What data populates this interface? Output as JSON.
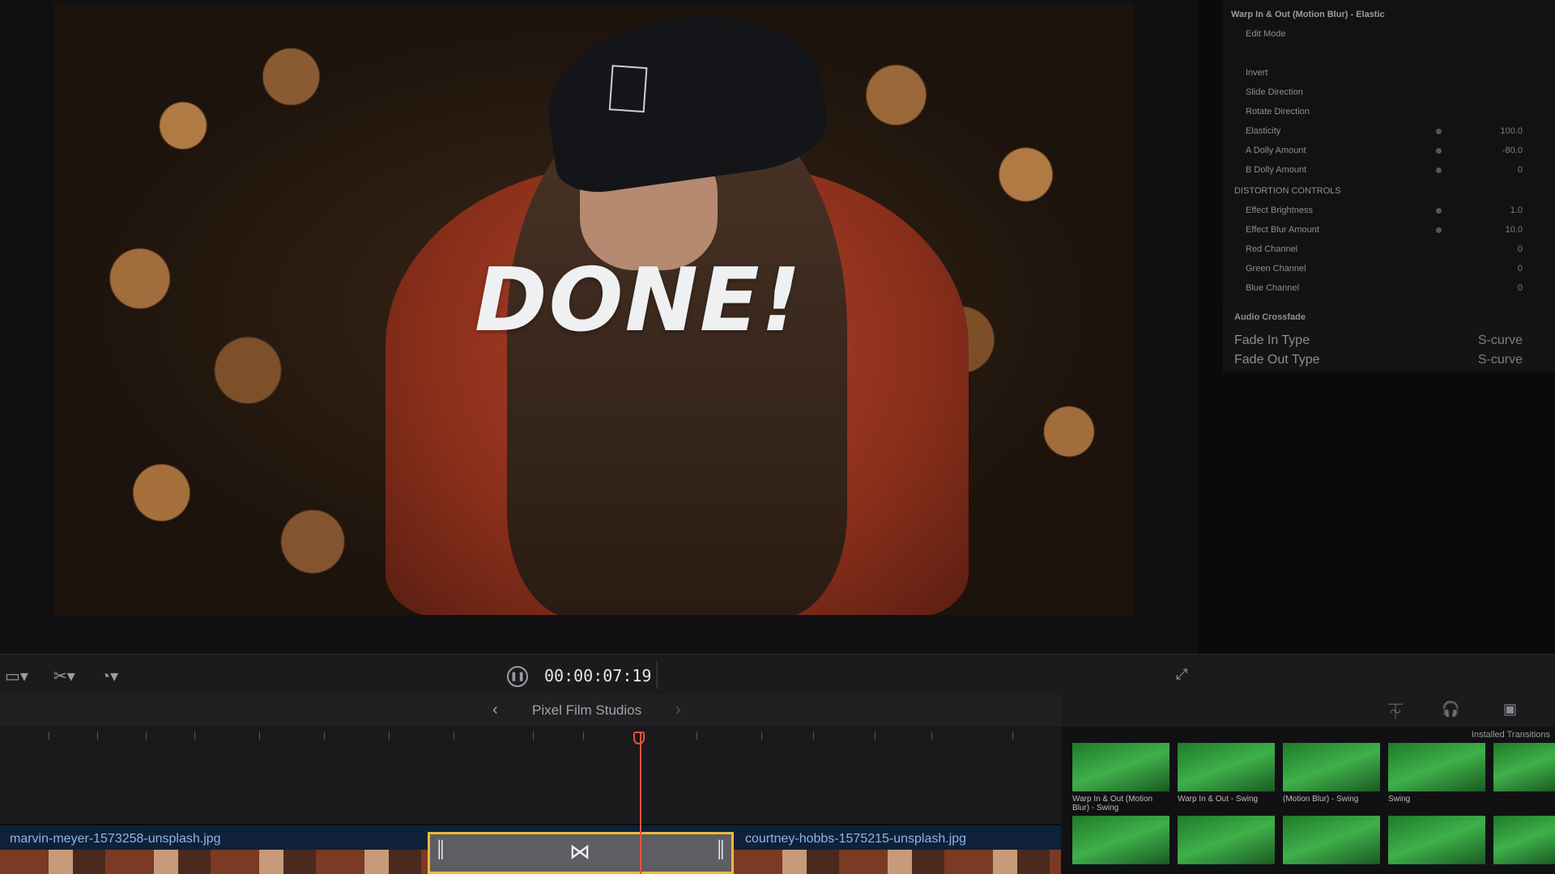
{
  "viewer": {
    "title_overlay": "DONE!"
  },
  "inspector": {
    "header": "Warp In & Out (Motion Blur) - Elastic",
    "rows": [
      {
        "label": "Edit Mode",
        "value": ""
      },
      {
        "label": "Invert",
        "value": ""
      },
      {
        "label": "Slide Direction",
        "value": ""
      },
      {
        "label": "Rotate Direction",
        "value": ""
      },
      {
        "label": "Elasticity",
        "value": "100.0"
      },
      {
        "label": "A Dolly Amount",
        "value": "-80.0"
      },
      {
        "label": "B Dolly Amount",
        "value": "0"
      }
    ],
    "distortion_section": "DISTORTION CONTROLS",
    "distortion_rows": [
      {
        "label": "Effect Brightness",
        "value": "1.0"
      },
      {
        "label": "Effect Blur Amount",
        "value": "10.0"
      },
      {
        "label": "Red Channel",
        "value": "0"
      },
      {
        "label": "Green Channel",
        "value": "0"
      },
      {
        "label": "Blue Channel",
        "value": "0"
      }
    ],
    "audio_section": "Audio Crossfade",
    "audio_rows": [
      {
        "label": "Fade In Type",
        "value": "S-curve"
      },
      {
        "label": "Fade Out Type",
        "value": "S-curve"
      }
    ]
  },
  "toolbar": {
    "timecode": "00:00:07:19"
  },
  "breadcrumb": {
    "label": "Pixel Film Studios"
  },
  "timeline": {
    "clip_left": "marvin-meyer-1573258-unsplash.jpg",
    "clip_right": "courtney-hobbs-1575215-unsplash.jpg"
  },
  "browser": {
    "installed_label": "Installed Transitions",
    "thumbs_top": [
      "Warp In & Out (Motion Blur) - Swing",
      "Warp In & Out - Swing",
      "(Motion Blur) - Swing",
      "Swing",
      ""
    ],
    "thumbs_bottom": [
      "",
      "",
      "",
      "",
      ""
    ]
  },
  "colors": {
    "accent_playhead": "#e2553f",
    "transition_border": "#e8b93c",
    "clip_track": "#0f2138"
  }
}
